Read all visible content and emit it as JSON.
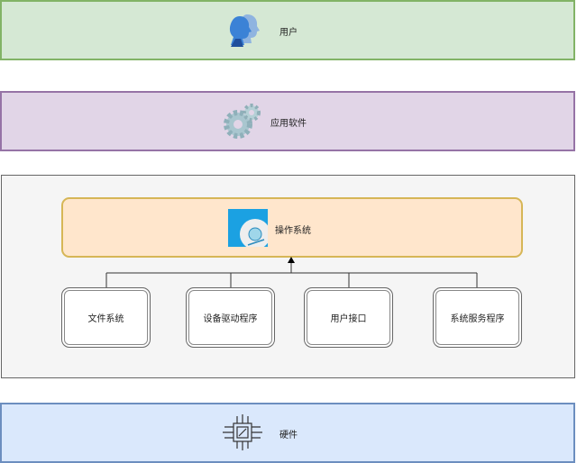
{
  "layers": {
    "user": {
      "label": "用户",
      "icon": "users-icon",
      "color": "#d5e8d4",
      "border": "#82b366"
    },
    "apps": {
      "label": "应用软件",
      "icon": "gears-icon",
      "color": "#e1d5e7",
      "border": "#9673a6"
    },
    "os": {
      "label": "操作系统",
      "icon": "os-disc-icon",
      "color": "#ffe6cc",
      "border": "#d6b656"
    },
    "hardware": {
      "label": "硬件",
      "icon": "chip-icon",
      "color": "#dae8fc",
      "border": "#6c8ebf"
    }
  },
  "components": [
    {
      "label": "文件系统"
    },
    {
      "label": "设备驱动程序"
    },
    {
      "label": "用户接口"
    },
    {
      "label": "系统服务程序"
    }
  ]
}
